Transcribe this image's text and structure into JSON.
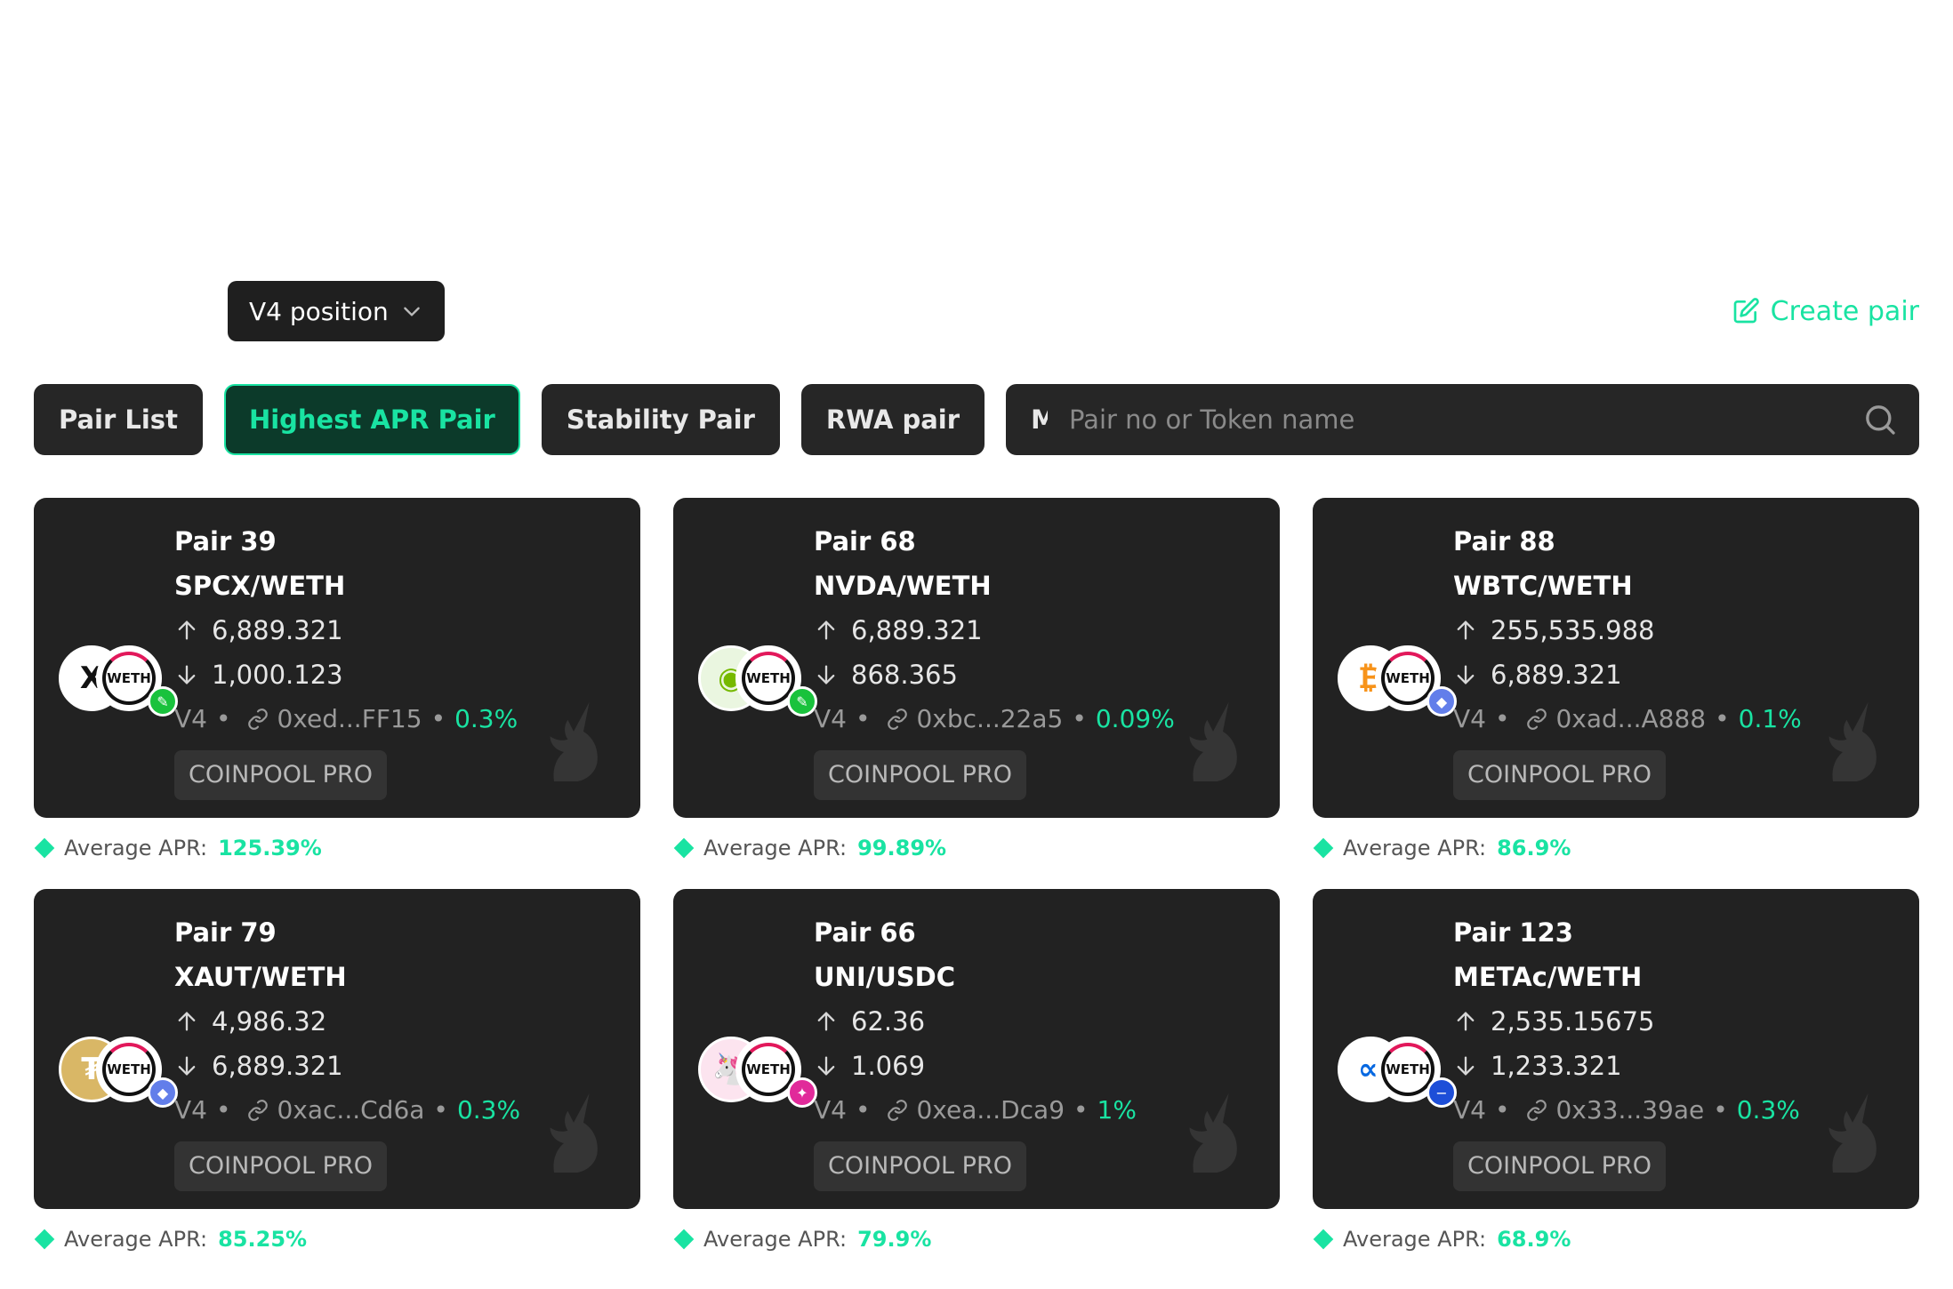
{
  "header": {
    "version_select": "V4 position",
    "create_pair": "Create pair"
  },
  "tabs": [
    {
      "label": "Pair List",
      "active": false
    },
    {
      "label": "Highest APR Pair",
      "active": true
    },
    {
      "label": "Stability Pair",
      "active": false
    },
    {
      "label": "RWA pair",
      "active": false
    },
    {
      "label": "My Pair",
      "active": false
    }
  ],
  "search": {
    "placeholder": "Pair no or Token name"
  },
  "cards": [
    {
      "pair_no": "Pair 39",
      "name": "SPCX/WETH",
      "up": "6,889.321",
      "down": "1,000.123",
      "version": "V4",
      "address": "0xed...FF15",
      "fee": "0.3%",
      "tag": "COINPOOL PRO",
      "apr_label": "Average APR:",
      "apr": "125.39%",
      "token_a": "X",
      "token_a_bg": "#ffffff",
      "token_a_color": "#111111",
      "badge_color": "#19c23c",
      "badge_icon": "leaf-icon"
    },
    {
      "pair_no": "Pair 68",
      "name": "NVDA/WETH",
      "up": "6,889.321",
      "down": "868.365",
      "version": "V4",
      "address": "0xbc...22a5",
      "fee": "0.09%",
      "tag": "COINPOOL PRO",
      "apr_label": "Average APR:",
      "apr": "99.89%",
      "token_a": "◉",
      "token_a_bg": "#eaf6e0",
      "token_a_color": "#76b900",
      "badge_color": "#19c23c",
      "badge_icon": "leaf-icon"
    },
    {
      "pair_no": "Pair 88",
      "name": "WBTC/WETH",
      "up": "255,535.988",
      "down": "6,889.321",
      "version": "V4",
      "address": "0xad...A888",
      "fee": "0.1%",
      "tag": "COINPOOL PRO",
      "apr_label": "Average APR:",
      "apr": "86.9%",
      "token_a": "₿",
      "token_a_bg": "#ffffff",
      "token_a_color": "#f7931a",
      "badge_color": "#627eea",
      "badge_icon": "ethereum-icon"
    },
    {
      "pair_no": "Pair 79",
      "name": "XAUT/WETH",
      "up": "4,986.32",
      "down": "6,889.321",
      "version": "V4",
      "address": "0xac...Cd6a",
      "fee": "0.3%",
      "tag": "COINPOOL PRO",
      "apr_label": "Average APR:",
      "apr": "85.25%",
      "token_a": "₮",
      "token_a_bg": "#d9b766",
      "token_a_color": "#ffffff",
      "badge_color": "#627eea",
      "badge_icon": "ethereum-icon"
    },
    {
      "pair_no": "Pair 66",
      "name": "UNI/USDC",
      "up": "62.36",
      "down": "1.069",
      "version": "V4",
      "address": "0xea...Dca9",
      "fee": "1%",
      "tag": "COINPOOL PRO",
      "apr_label": "Average APR:",
      "apr": "79.9%",
      "token_a": "🦄",
      "token_a_bg": "#fce4ef",
      "token_a_color": "#ff007a",
      "badge_color": "#e12a9a",
      "badge_icon": "sparkle-icon"
    },
    {
      "pair_no": "Pair 123",
      "name": "METAc/WETH",
      "up": "2,535.15675",
      "down": "1,233.321",
      "version": "V4",
      "address": "0x33...39ae",
      "fee": "0.3%",
      "tag": "COINPOOL PRO",
      "apr_label": "Average APR:",
      "apr": "68.9%",
      "token_a": "∞",
      "token_a_bg": "#ffffff",
      "token_a_color": "#0668e1",
      "badge_color": "#1d4ed8",
      "badge_icon": "minus-icon"
    }
  ]
}
